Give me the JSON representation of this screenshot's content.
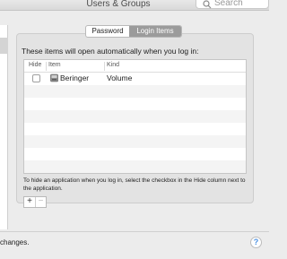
{
  "window": {
    "title": "Users & Groups"
  },
  "search": {
    "placeholder": "Search"
  },
  "tabs": [
    {
      "label": "Password",
      "selected": false
    },
    {
      "label": "Login Items",
      "selected": true
    }
  ],
  "login_items": {
    "heading": "These items will open automatically when you log in:",
    "columns": [
      "Hide",
      "Item",
      "Kind"
    ],
    "rows": [
      {
        "hide": false,
        "item": "Beringer",
        "kind": "Volume",
        "icon": "drive-icon"
      }
    ],
    "help_text": "To hide an application when you log in, select the checkbox in the Hide column next to the application.",
    "add_label": "+",
    "remove_label": "−"
  },
  "footer": {
    "text": "changes.",
    "help_label": "?"
  },
  "colors": {
    "selected_tab": "#9b9b9b",
    "panel": "#e3e3e3",
    "window": "#ececec"
  }
}
